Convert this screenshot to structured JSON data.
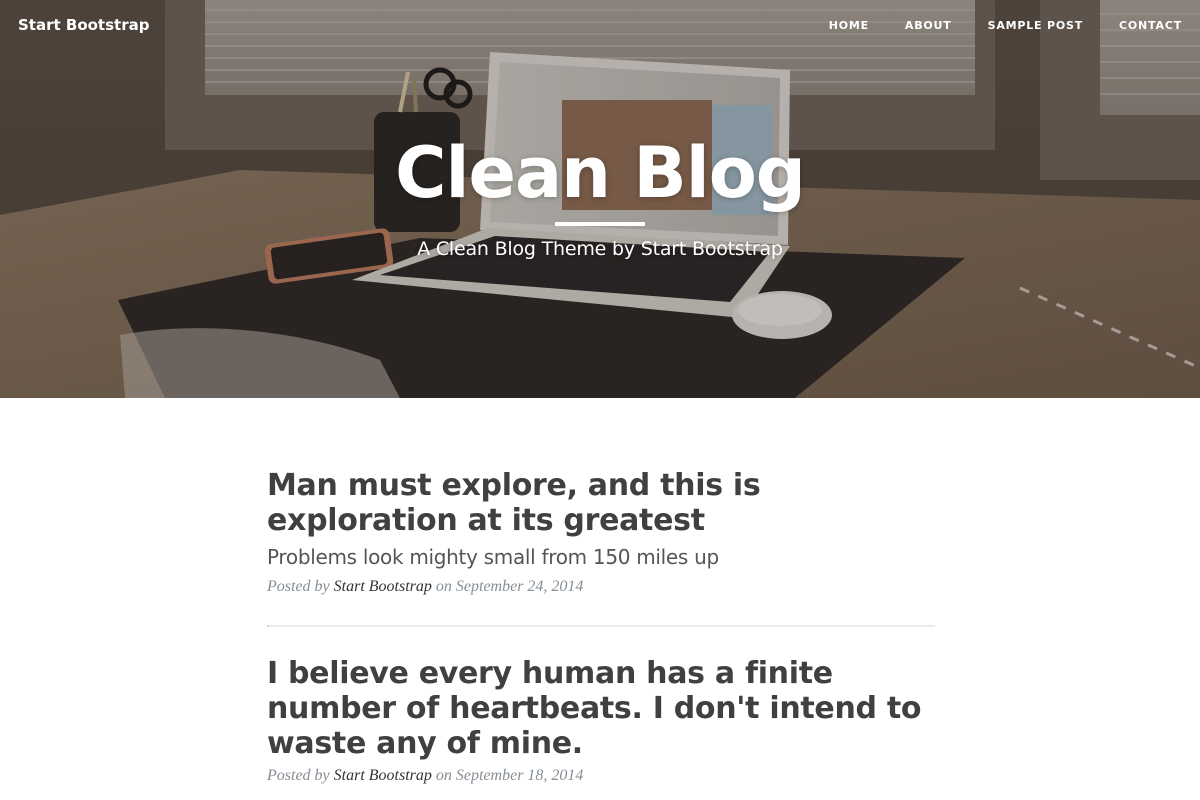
{
  "navbar": {
    "brand": "Start Bootstrap",
    "links": [
      {
        "label": "HOME"
      },
      {
        "label": "ABOUT"
      },
      {
        "label": "SAMPLE POST"
      },
      {
        "label": "CONTACT"
      }
    ]
  },
  "header": {
    "title": "Clean Blog",
    "subtitle": "A Clean Blog Theme by Start Bootstrap"
  },
  "posts": [
    {
      "title": "Man must explore, and this is exploration at its greatest",
      "subtitle": "Problems look mighty small from 150 miles up",
      "meta": {
        "prefix": "Posted by",
        "author": "Start Bootstrap",
        "on": "on",
        "date": "September 24, 2014"
      }
    },
    {
      "title": "I believe every human has a finite number of heartbeats. I don't intend to waste any of mine.",
      "subtitle": "",
      "meta": {
        "prefix": "Posted by",
        "author": "Start Bootstrap",
        "on": "on",
        "date": "September 18, 2014"
      }
    }
  ],
  "colors": {
    "heading_text": "#404040",
    "subtitle_text": "#555555",
    "meta_text": "#868e96",
    "divider": "#e9ecef",
    "masthead_text": "#ffffff"
  }
}
